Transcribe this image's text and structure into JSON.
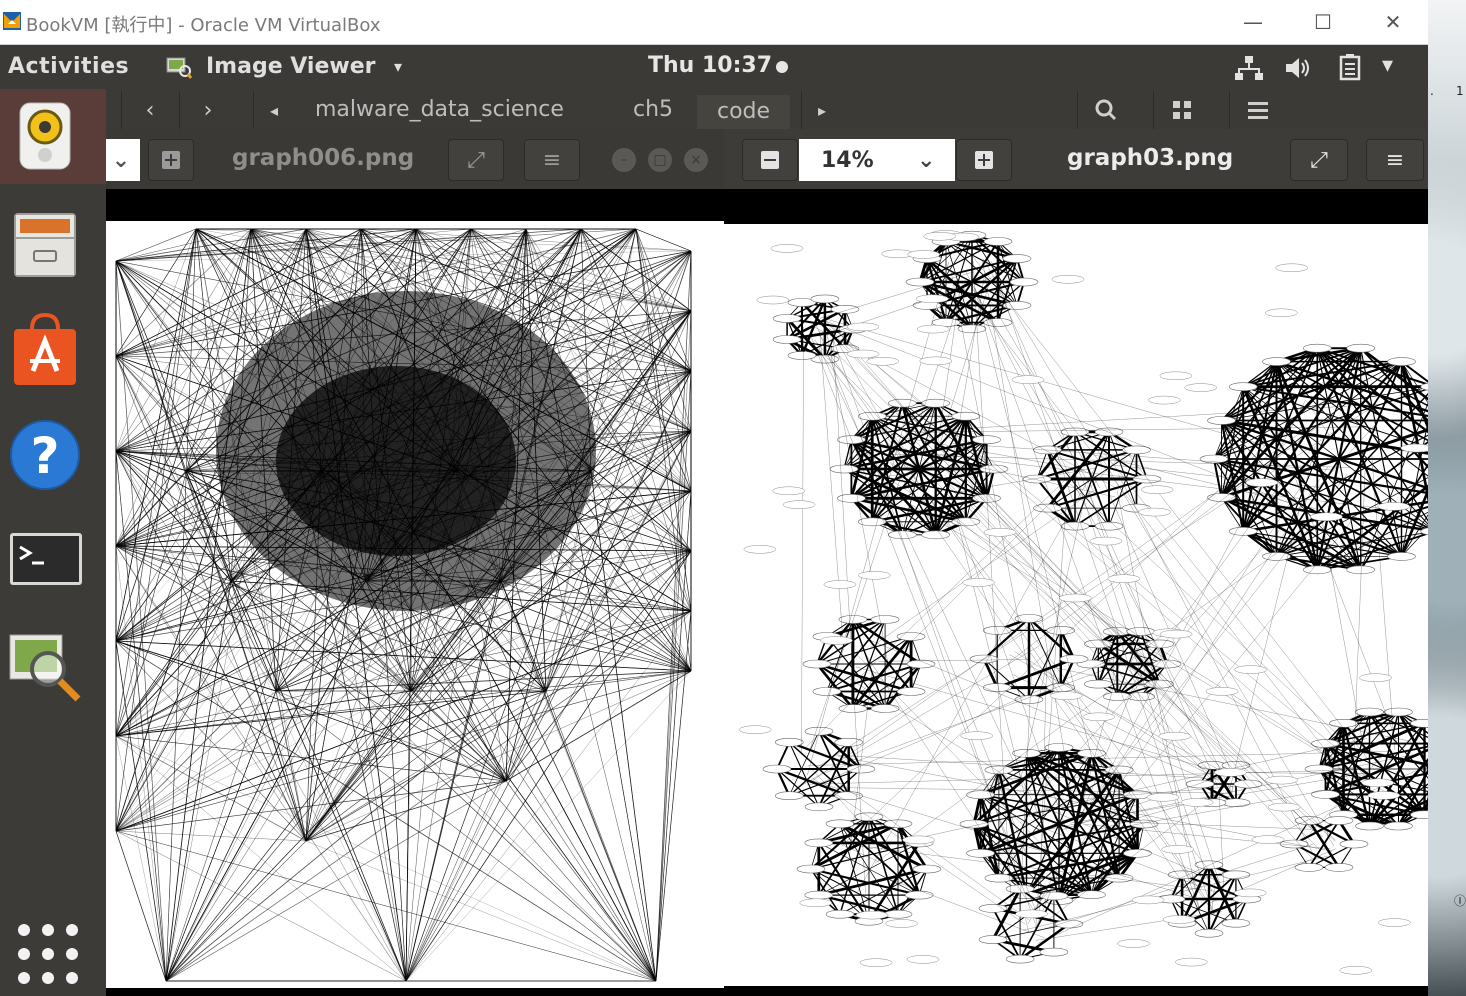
{
  "host": {
    "title": "BookVM [執行中] - Oracle VM VirtualBox",
    "controls": {
      "minimize": "—",
      "maximize": "☐",
      "close": "✕"
    },
    "desktop_fragments": [
      ".",
      "1",
      "Ⓘ"
    ]
  },
  "topbar": {
    "activities": "Activities",
    "app_name": "Image Viewer",
    "app_caret": "▾",
    "clock": "Thu 10:37",
    "tray": {
      "network": "network-icon",
      "volume": "volume-icon",
      "battery": "battery-icon",
      "menu": "▾"
    }
  },
  "files_toolbar": {
    "back": "‹",
    "forward": "›",
    "left_scroll": "◂",
    "crumbs": [
      "malware_data_science",
      "ch5",
      "code"
    ],
    "right_scroll": "▸"
  },
  "dock": {
    "items": [
      "rhythmbox-icon",
      "files-icon",
      "software-center-icon",
      "help-icon",
      "terminal-icon",
      "image-viewer-icon"
    ],
    "show_apps": "show-applications-icon"
  },
  "viewer_left": {
    "dropdown_caret": "⌄",
    "zoom_in": "+",
    "title": "graph006.png",
    "fullscreen": "⤢",
    "menu": "≡",
    "controls": {
      "minimize": "–",
      "maximize": "□",
      "close": "×"
    }
  },
  "viewer_right": {
    "zoom_out": "−",
    "zoom_value": "14%",
    "zoom_caret": "⌄",
    "zoom_in": "+",
    "title": "graph03.png",
    "fullscreen": "⤢",
    "menu": "≡"
  },
  "colors": {
    "host_bg": "#ffffff",
    "guest_topbar": "#3b3a37",
    "headerbar": "#3d3c39",
    "dock": "#3c3b38",
    "software_center": "#e95420",
    "help_blue": "#2a7ad5"
  }
}
